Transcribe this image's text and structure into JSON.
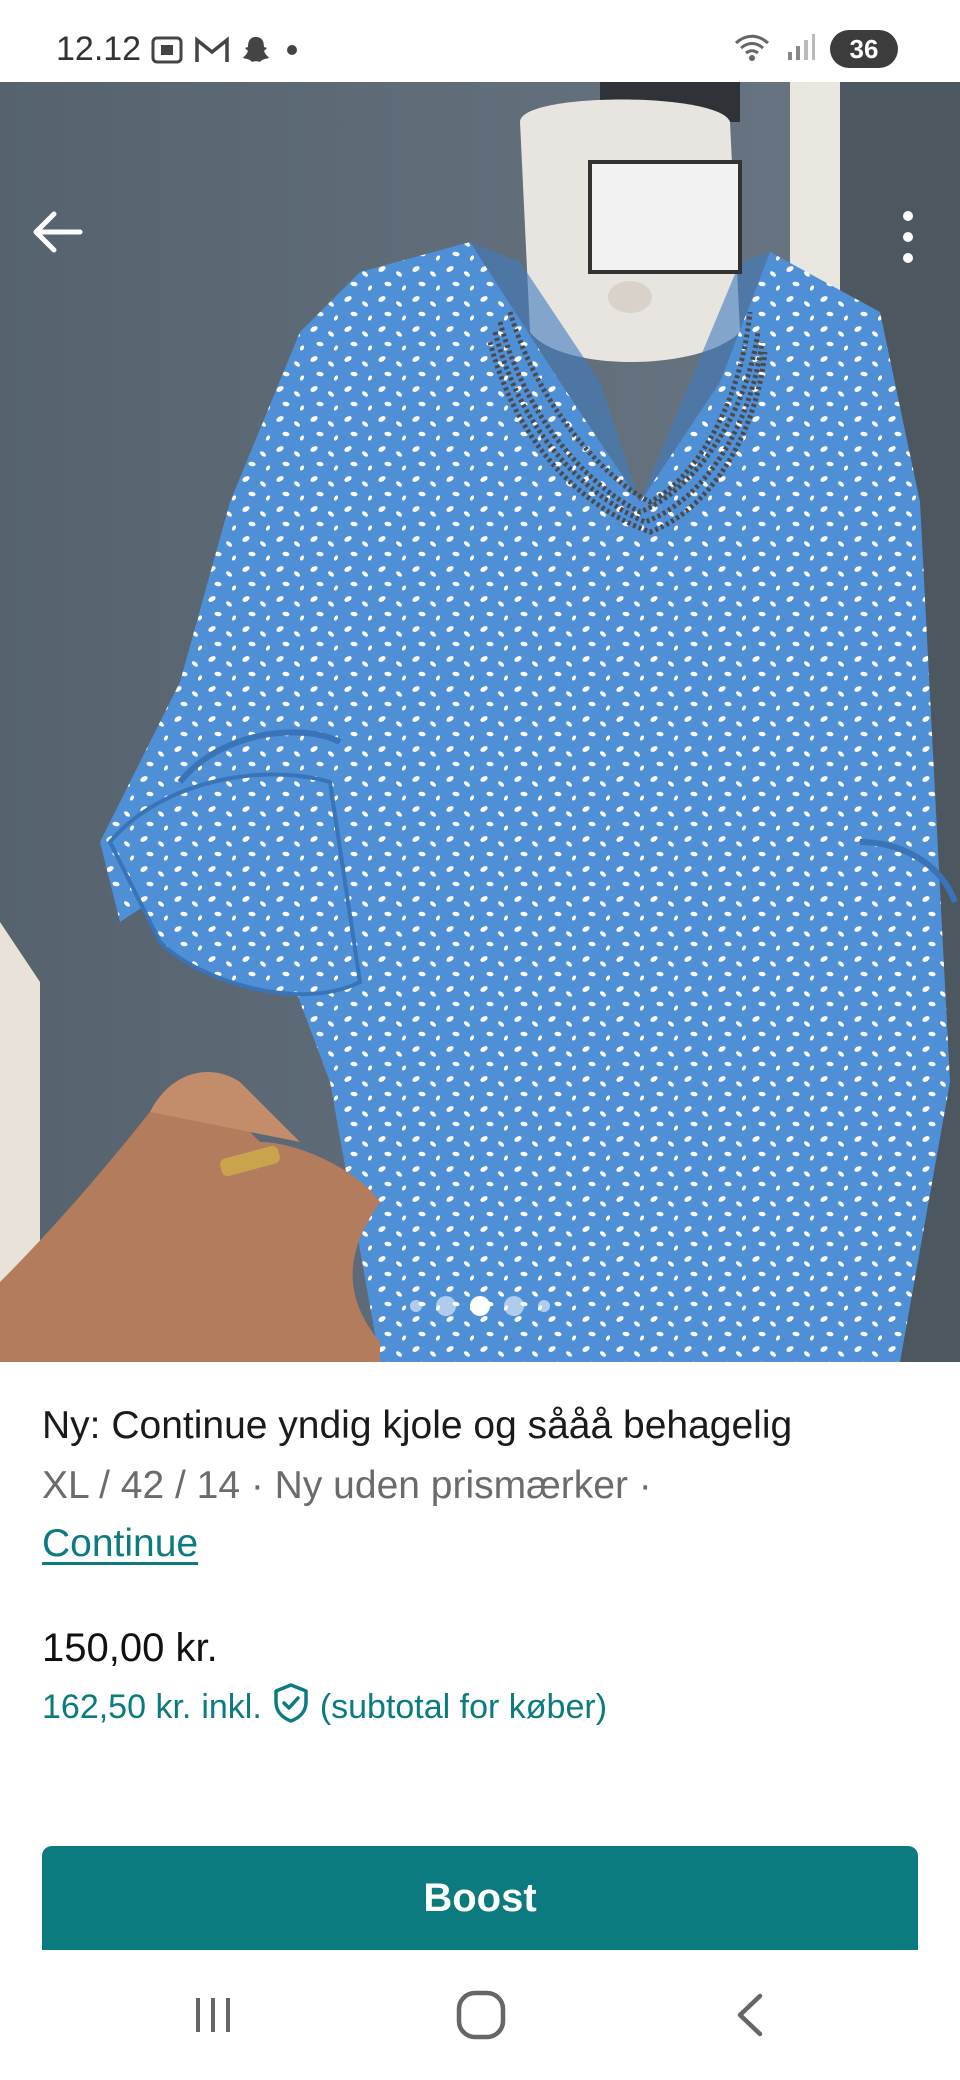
{
  "status_bar": {
    "time": "12.12",
    "battery": "36",
    "icons_left": [
      "screenshot-icon",
      "gmail-icon",
      "snapchat-icon",
      "dot-icon"
    ],
    "icons_right": [
      "wifi-icon",
      "signal-icon"
    ]
  },
  "photo": {
    "alt": "Blue dress with white pattern on mannequin",
    "carousel_count": 5,
    "carousel_active_index": 2
  },
  "product": {
    "title": "Ny: Continue yndig kjole og sååå behagelig",
    "meta": "XL / 42 / 14 · Ny uden prismærker ·",
    "brand": "Continue",
    "price": "150,00 kr.",
    "buyer_price": "162,50 kr.",
    "buyer_incl": "inkl.",
    "buyer_note": "(subtotal for køber)"
  },
  "actions": {
    "boost_label": "Boost"
  },
  "colors": {
    "accent": "#0b7b80",
    "dress_blue": "#4f8fd6",
    "wall": "#5f6d7d"
  }
}
